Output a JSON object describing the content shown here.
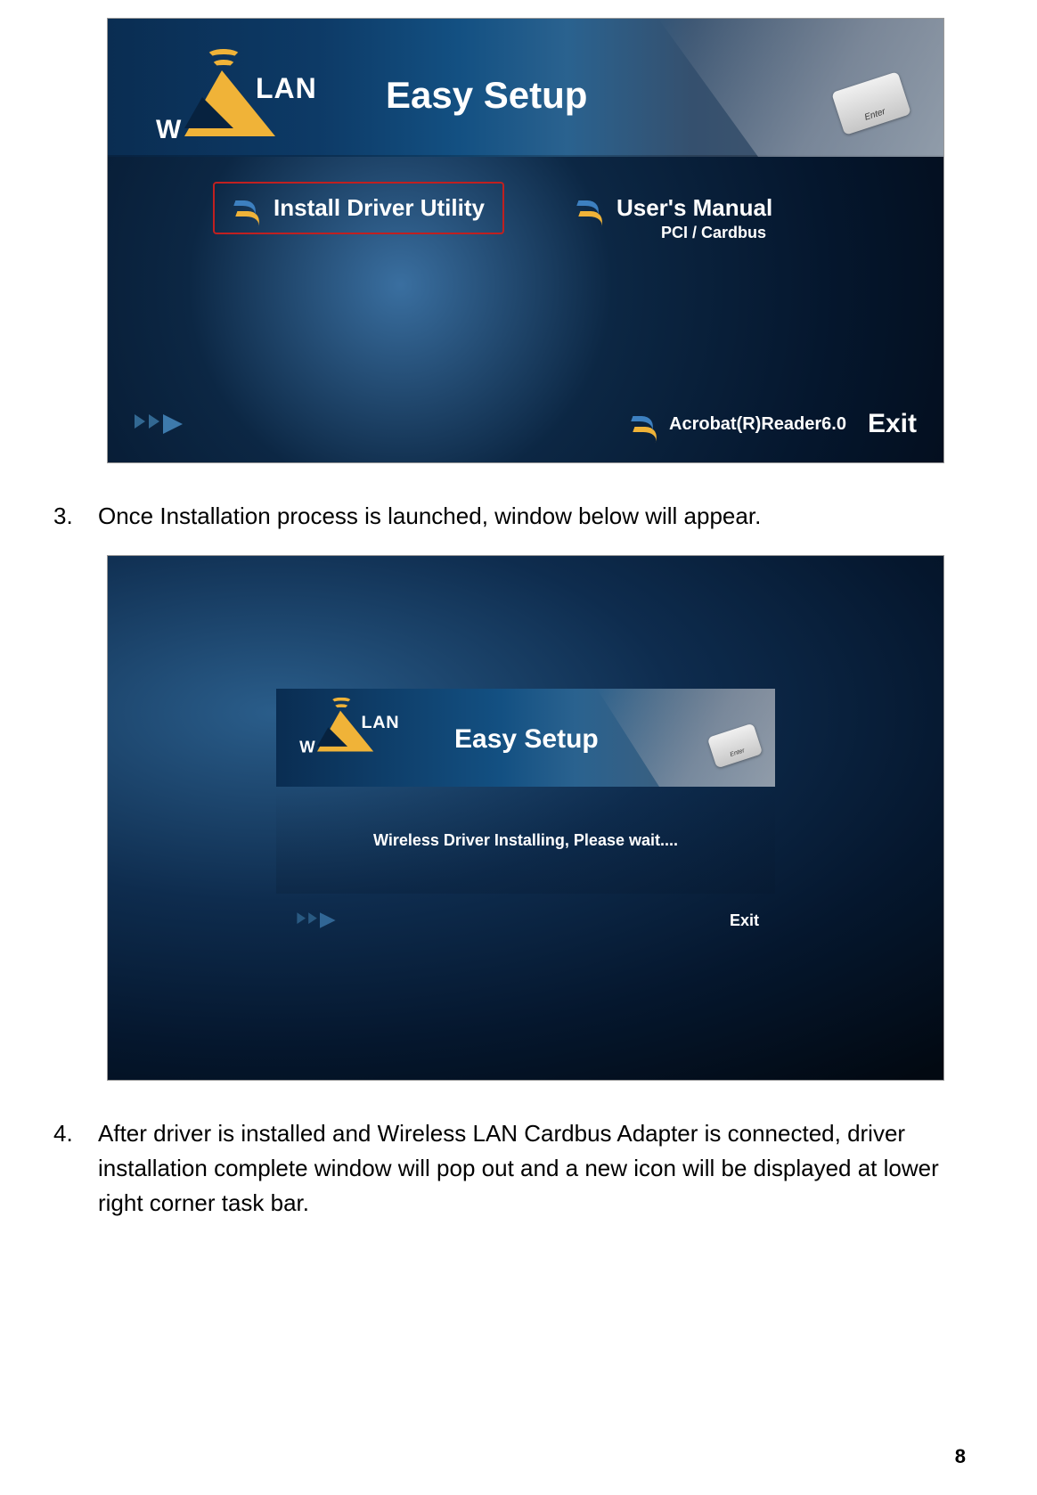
{
  "screenshot1": {
    "logo_w": "W",
    "logo_lan": "LAN",
    "title": "Easy Setup",
    "enter_key": "Enter",
    "install_label": "Install Driver Utility",
    "manual_label": "User's Manual",
    "manual_sub": "PCI / Cardbus",
    "acrobat_label": "Acrobat(R)Reader6.0",
    "exit_label": "Exit"
  },
  "step3": {
    "num": "3.",
    "text": "Once Installation process is launched, window below will appear."
  },
  "screenshot2": {
    "logo_w": "W",
    "logo_lan": "LAN",
    "title": "Easy Setup",
    "enter_key": "Enter",
    "status": "Wireless Driver Installing, Please wait....",
    "exit_label": "Exit"
  },
  "step4": {
    "num": "4.",
    "text": "After driver is installed and Wireless LAN Cardbus Adapter is connected, driver installation complete window will pop out and a new icon will be displayed at lower right corner task bar."
  },
  "page_number": "8"
}
